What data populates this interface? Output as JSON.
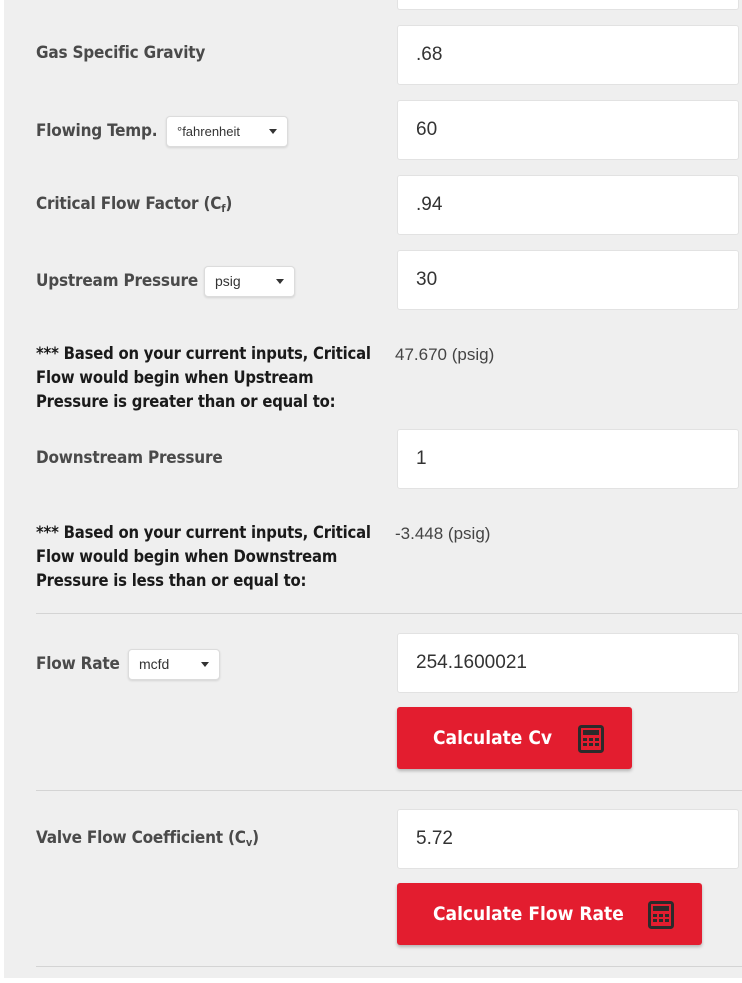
{
  "fields": {
    "gas_specific_gravity": {
      "label": "Gas Specific Gravity",
      "value": ".68"
    },
    "flowing_temp": {
      "label": "Flowing Temp.",
      "unit": "°fahrenheit",
      "value": "60"
    },
    "critical_flow_factor": {
      "label": "Critical Flow Factor (C",
      "label_sub": "f",
      "label_end": ")",
      "value": ".94"
    },
    "upstream_pressure": {
      "label": "Upstream Pressure",
      "unit": "psig",
      "value": "30"
    },
    "downstream_pressure": {
      "label": "Downstream Pressure",
      "value": "1"
    },
    "flow_rate": {
      "label": "Flow Rate",
      "unit": "mcfd",
      "value": "254.1600021"
    },
    "valve_flow_coefficient": {
      "label": "Valve Flow Coefficient (C",
      "label_sub": "v",
      "label_end": ")",
      "value": "5.72"
    }
  },
  "notes": {
    "upstream": {
      "text": "*** Based on your current inputs, Critical Flow would begin when Upstream Pressure is greater than or equal to:",
      "value": "47.670 (psig)"
    },
    "downstream": {
      "text": "*** Based on your current inputs, Critical Flow would begin when Downstream Pressure is less than or equal to:",
      "value": "-3.448 (psig)"
    }
  },
  "buttons": {
    "calculate_cv": "Calculate Cv",
    "calculate_flow_rate": "Calculate Flow Rate"
  },
  "colors": {
    "accent": "#e31d2f",
    "panel": "#efefef"
  },
  "icons": {
    "button_icon": "calculator-icon"
  }
}
